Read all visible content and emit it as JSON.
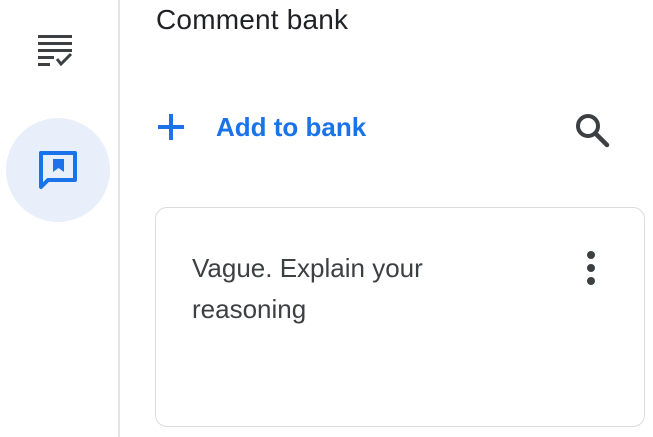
{
  "rail": {
    "items": [
      {
        "icon": "rubric-checklist-icon",
        "active": false
      },
      {
        "icon": "comment-bank-icon",
        "active": true
      }
    ],
    "active_bg": "#e8effa",
    "active_icon_color": "#1a73e8",
    "icon_color": "#3c4043"
  },
  "panel": {
    "title": "Comment bank",
    "add_label": "Add to bank",
    "add_icon": "plus-icon",
    "search_icon": "search-icon",
    "accent": "#1a73e8"
  },
  "comments": [
    {
      "text": "Vague. Explain your reasoning",
      "menu_icon": "more-vertical-icon"
    }
  ]
}
